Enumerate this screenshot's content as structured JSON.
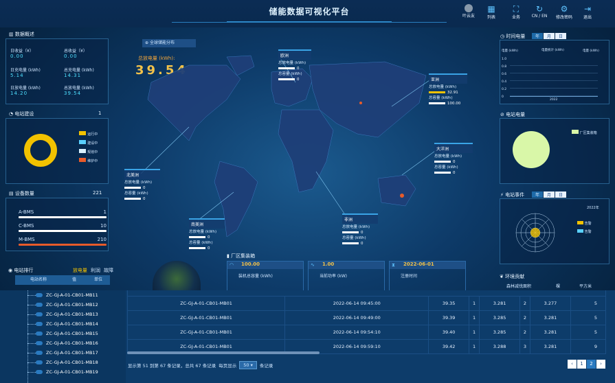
{
  "header": {
    "title": "储能数据可视化平台",
    "buttons": [
      {
        "label": "叶云友",
        "icon": "avatar-icon"
      },
      {
        "label": "列表",
        "icon": "grid-icon"
      },
      {
        "label": "业务",
        "icon": "org-chart-icon"
      },
      {
        "label": "CN / EN",
        "icon": "refresh-icon"
      },
      {
        "label": "修改密码",
        "icon": "gear-icon"
      },
      {
        "label": "退出",
        "icon": "exit-icon"
      }
    ]
  },
  "overview": {
    "title": "数据概述",
    "items": [
      {
        "label": "日收益（¥）",
        "value": "0.00"
      },
      {
        "label": "总收益（¥）",
        "value": "0.00"
      },
      {
        "label": "日充电量 (kWh)",
        "value": "5.14"
      },
      {
        "label": "总充电量 (kWh)",
        "value": "14.31"
      },
      {
        "label": "日放电量 (kWh)",
        "value": "14.20"
      },
      {
        "label": "总放电量 (kWh)",
        "value": "39.54"
      }
    ]
  },
  "station_build": {
    "title": "电站建设",
    "count": "1",
    "legend": [
      {
        "label": "运行中",
        "color": "#f2c200"
      },
      {
        "label": "建设中",
        "color": "#5ad0ff"
      },
      {
        "label": "规划中",
        "color": "#d8f0ff"
      },
      {
        "label": "维护中",
        "color": "#e85b2a"
      }
    ]
  },
  "devices": {
    "title": "设备数量",
    "total": "221",
    "items": [
      {
        "label": "A-BMS",
        "value": "1",
        "pct": 1
      },
      {
        "label": "C-BMS",
        "value": "10",
        "pct": 5
      },
      {
        "label": "M-BMS",
        "value": "210",
        "pct": 100
      }
    ]
  },
  "ranking": {
    "title": "电站排行",
    "tabs": [
      "放电量",
      "利润",
      "故障"
    ],
    "columns": [
      "电站名称",
      "值",
      "单位"
    ]
  },
  "map": {
    "badge": "全球储能分布",
    "total_label": "总放电量 (kWh):",
    "total_value": "39.54",
    "regions": [
      {
        "name": "欧洲",
        "l1": "总放电量 (kWh)",
        "v1": "0",
        "l2": "总容量 (kWh)",
        "v2": "0"
      },
      {
        "name": "亚洲",
        "l1": "总放电量 (kWh)",
        "v1": "32.91",
        "l2": "总容量 (kWh)",
        "v2": "100.00"
      },
      {
        "name": "大洋洲",
        "l1": "总放电量 (kWh)",
        "v1": "0",
        "l2": "总容量 (kWh)",
        "v2": "0"
      },
      {
        "name": "北美洲",
        "l1": "总放电量 (kWh)",
        "v1": "0",
        "l2": "总容量 (kWh)",
        "v2": "0"
      },
      {
        "name": "南美洲",
        "l1": "总放电量 (kWh)",
        "v1": "0",
        "l2": "总容量 (kWh)",
        "v2": "0"
      },
      {
        "name": "非洲",
        "l1": "总放电量 (kWh)",
        "v1": "0",
        "l2": "总容量 (kWh)",
        "v2": "0"
      }
    ]
  },
  "factory": {
    "title": "厂区集装箱",
    "stats": [
      {
        "value": "100.00",
        "label": "装机总容量 (kWh)"
      },
      {
        "value": "1.00",
        "label": "当前功率 (kW)"
      },
      {
        "value": "2022-06-01",
        "label": "注册时间"
      }
    ]
  },
  "time_power": {
    "title": "时间电量",
    "tabs": [
      "年",
      "月",
      "日"
    ],
    "left_axis": "电量 (kWh)",
    "right_axis": "电量 (kWh)",
    "chart_title": "电量统计 (kWh)",
    "y_ticks": [
      "1.0",
      "0.8",
      "0.6",
      "0.4",
      "0.2",
      "0"
    ],
    "x_label": "2022"
  },
  "station_power": {
    "title": "电站电量",
    "legend": "厂区集装箱"
  },
  "events": {
    "title": "电站事件",
    "tabs": [
      "年",
      "月",
      "日"
    ],
    "year": "2022年",
    "legend": [
      {
        "label": "告警",
        "color": "#f2c200"
      },
      {
        "label": "告警",
        "color": "#5ad0ff"
      }
    ],
    "ticks": [
      "12",
      "1",
      "11",
      "2",
      "10",
      "3",
      "9",
      "4",
      "8",
      "5",
      "7",
      "6"
    ]
  },
  "env": {
    "title": "环境贡献",
    "cols": [
      "森林减伐面积",
      "棵",
      "平方米"
    ]
  },
  "tree": {
    "items": [
      "ZC-GJ-A-01-CB01-MB11",
      "ZC-GJ-A-01-CB01-MB12",
      "ZC-GJ-A-01-CB01-MB13",
      "ZC-GJ-A-01-CB01-MB14",
      "ZC-GJ-A-01-CB01-MB15",
      "ZC-GJ-A-01-CB01-MB16",
      "ZC-GJ-A-01-CB01-MB17",
      "ZC-GJ-A-01-CB01-MB18",
      "ZC-GJ-A-01-CB01-MB19"
    ]
  },
  "table": {
    "rows": [
      [
        "ZC-GJ-A-01-CB01-MB01",
        "2022-06-14 09:45:00",
        "39.35",
        "1",
        "3.281",
        "2",
        "3.277",
        "5"
      ],
      [
        "ZC-GJ-A-01-CB01-MB01",
        "2022-06-14 09:49:00",
        "39.39",
        "1",
        "3.285",
        "2",
        "3.281",
        "5"
      ],
      [
        "ZC-GJ-A-01-CB01-MB01",
        "2022-06-14 09:54:10",
        "39.40",
        "1",
        "3.285",
        "2",
        "3.281",
        "5"
      ],
      [
        "ZC-GJ-A-01-CB01-MB01",
        "2022-06-14 09:59:10",
        "39.42",
        "1",
        "3.288",
        "3",
        "3.281",
        "9"
      ]
    ]
  },
  "pagination": {
    "info": "显示第 51 到第 67 条记录，总共 67 条记录",
    "per_page_label": "每页显示",
    "per_page": "50",
    "suffix": "条记录",
    "pages": [
      "‹",
      "1",
      "2",
      "›"
    ]
  }
}
